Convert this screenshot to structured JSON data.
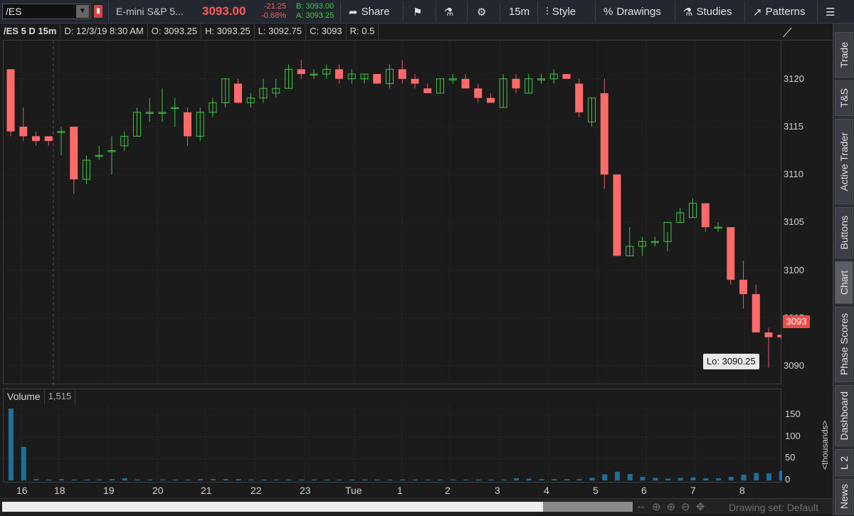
{
  "toolbar": {
    "symbol": "/ES",
    "description": "E-mini S&P 5...",
    "last": "3093.00",
    "net_change": "-21.25",
    "pct_change": "-0.68%",
    "bid": "B: 3093.00",
    "ask": "A: 3093.25",
    "share": "Share",
    "interval": "15m",
    "style": "Style",
    "drawings": "Drawings",
    "studies": "Studies",
    "patterns": "Patterns"
  },
  "chart_header": {
    "symbol": "/ES 5 D 15m",
    "date": "D: 12/3/19 8:30 AM",
    "open": "O: 3093.25",
    "high": "H: 3093.25",
    "low": "L: 3092.75",
    "close": "C: 3093",
    "range": "R: 0.5"
  },
  "price_axis": [
    "3120",
    "3115",
    "3110",
    "3105",
    "3100",
    "3095",
    "3090"
  ],
  "price_tag": "3093",
  "lo_tag": "Lo: 3090.25",
  "volume": {
    "title": "Volume",
    "value": "1,515",
    "axis": [
      "150",
      "100",
      "50",
      "0"
    ],
    "units": "<thousands>"
  },
  "date_axis": [
    "16",
    "18",
    "19",
    "20",
    "21",
    "22",
    "23",
    "Tue",
    "1",
    "2",
    "3",
    "4",
    "5",
    "6",
    "7",
    "8"
  ],
  "footer": {
    "drawing_set": "Drawing set: Default"
  },
  "right_tabs": [
    "Trade",
    "T&S",
    "Active Trader",
    "Buttons",
    "Chart",
    "Phase Scores",
    "Dashboard",
    "L 2",
    "News"
  ],
  "colors": {
    "up": "#3ec73e",
    "down": "#ff6b6b",
    "volume": "#1f6f9e"
  },
  "chart_data": {
    "type": "candlestick",
    "y_range": [
      3088,
      3124
    ],
    "candles": [
      {
        "o": 3121,
        "h": 3121,
        "l": 3114,
        "c": 3114.5
      },
      {
        "o": 3115,
        "h": 3117,
        "l": 3113.5,
        "c": 3114
      },
      {
        "o": 3114,
        "h": 3114.5,
        "l": 3113,
        "c": 3113.5
      },
      {
        "o": 3114,
        "h": 3114,
        "l": 3113,
        "c": 3113.5
      },
      {
        "o": 3114.5,
        "h": 3115,
        "l": 3112,
        "c": 3114.5
      },
      {
        "o": 3115,
        "h": 3115,
        "l": 3108,
        "c": 3109.5
      },
      {
        "o": 3109.5,
        "h": 3112,
        "l": 3109,
        "c": 3111.5
      },
      {
        "o": 3112,
        "h": 3113,
        "l": 3111.5,
        "c": 3112
      },
      {
        "o": 3112.5,
        "h": 3114,
        "l": 3110,
        "c": 3112.5
      },
      {
        "o": 3113,
        "h": 3114.5,
        "l": 3112.5,
        "c": 3114
      },
      {
        "o": 3114,
        "h": 3117,
        "l": 3114,
        "c": 3116.5
      },
      {
        "o": 3116.5,
        "h": 3118,
        "l": 3115.5,
        "c": 3116.5
      },
      {
        "o": 3116.5,
        "h": 3119,
        "l": 3115.5,
        "c": 3116.5
      },
      {
        "o": 3117,
        "h": 3118,
        "l": 3115,
        "c": 3117
      },
      {
        "o": 3116.5,
        "h": 3117,
        "l": 3113,
        "c": 3114
      },
      {
        "o": 3114,
        "h": 3117,
        "l": 3113.5,
        "c": 3116.5
      },
      {
        "o": 3116.5,
        "h": 3118,
        "l": 3116,
        "c": 3117.5
      },
      {
        "o": 3117.5,
        "h": 3120,
        "l": 3117,
        "c": 3120
      },
      {
        "o": 3119.5,
        "h": 3120,
        "l": 3117.5,
        "c": 3117.5
      },
      {
        "o": 3117.5,
        "h": 3118.5,
        "l": 3117,
        "c": 3118
      },
      {
        "o": 3118,
        "h": 3120,
        "l": 3117.5,
        "c": 3119
      },
      {
        "o": 3118.5,
        "h": 3120,
        "l": 3118,
        "c": 3119
      },
      {
        "o": 3119,
        "h": 3121.5,
        "l": 3119,
        "c": 3121
      },
      {
        "o": 3121,
        "h": 3122,
        "l": 3120,
        "c": 3120.5
      },
      {
        "o": 3120.5,
        "h": 3121,
        "l": 3120,
        "c": 3120.5
      },
      {
        "o": 3120.5,
        "h": 3121.5,
        "l": 3120,
        "c": 3121
      },
      {
        "o": 3121,
        "h": 3121.5,
        "l": 3119.5,
        "c": 3120
      },
      {
        "o": 3120,
        "h": 3121,
        "l": 3119.5,
        "c": 3120.5
      },
      {
        "o": 3120,
        "h": 3120.5,
        "l": 3119.5,
        "c": 3120.5
      },
      {
        "o": 3120.5,
        "h": 3120.5,
        "l": 3119.5,
        "c": 3119.5
      },
      {
        "o": 3119.5,
        "h": 3121.5,
        "l": 3119,
        "c": 3121
      },
      {
        "o": 3121,
        "h": 3122,
        "l": 3119.5,
        "c": 3120
      },
      {
        "o": 3120,
        "h": 3120.5,
        "l": 3119,
        "c": 3119.5
      },
      {
        "o": 3119,
        "h": 3119.5,
        "l": 3118.5,
        "c": 3118.5
      },
      {
        "o": 3118.5,
        "h": 3120,
        "l": 3118.5,
        "c": 3120
      },
      {
        "o": 3120,
        "h": 3120.5,
        "l": 3119.5,
        "c": 3120
      },
      {
        "o": 3120,
        "h": 3120.5,
        "l": 3119,
        "c": 3119
      },
      {
        "o": 3119,
        "h": 3119.5,
        "l": 3117.5,
        "c": 3118
      },
      {
        "o": 3118,
        "h": 3118.5,
        "l": 3117.5,
        "c": 3117.5
      },
      {
        "o": 3117,
        "h": 3120.5,
        "l": 3117,
        "c": 3120
      },
      {
        "o": 3120,
        "h": 3120.5,
        "l": 3118.5,
        "c": 3119
      },
      {
        "o": 3118.5,
        "h": 3120.5,
        "l": 3118.5,
        "c": 3120
      },
      {
        "o": 3120,
        "h": 3120.5,
        "l": 3119.5,
        "c": 3120
      },
      {
        "o": 3120,
        "h": 3121,
        "l": 3119.5,
        "c": 3120.5
      },
      {
        "o": 3120.5,
        "h": 3120.5,
        "l": 3120,
        "c": 3120
      },
      {
        "o": 3119.5,
        "h": 3120,
        "l": 3116,
        "c": 3116.5
      },
      {
        "o": 3115.5,
        "h": 3118,
        "l": 3115,
        "c": 3118
      },
      {
        "o": 3118.5,
        "h": 3120,
        "l": 3108.5,
        "c": 3110
      },
      {
        "o": 3110,
        "h": 3110,
        "l": 3101.5,
        "c": 3101.5
      },
      {
        "o": 3101.5,
        "h": 3104.5,
        "l": 3101.5,
        "c": 3102.5
      },
      {
        "o": 3102.5,
        "h": 3103.5,
        "l": 3101.5,
        "c": 3103
      },
      {
        "o": 3103,
        "h": 3103.5,
        "l": 3102.5,
        "c": 3103
      },
      {
        "o": 3103,
        "h": 3104,
        "l": 3102,
        "c": 3105
      },
      {
        "o": 3105,
        "h": 3106.5,
        "l": 3105,
        "c": 3106
      },
      {
        "o": 3105.5,
        "h": 3107.5,
        "l": 3105.5,
        "c": 3107
      },
      {
        "o": 3107,
        "h": 3107,
        "l": 3104,
        "c": 3104.5
      },
      {
        "o": 3104.5,
        "h": 3105,
        "l": 3104,
        "c": 3104.5
      },
      {
        "o": 3104.5,
        "h": 3104.5,
        "l": 3098.5,
        "c": 3099
      },
      {
        "o": 3099,
        "h": 3101,
        "l": 3096,
        "c": 3097.5
      },
      {
        "o": 3097.5,
        "h": 3098.5,
        "l": 3093.5,
        "c": 3093.5
      },
      {
        "o": 3093.5,
        "h": 3094,
        "l": 3090.25,
        "c": 3093
      },
      {
        "o": 3093.25,
        "h": 3093.25,
        "l": 3092.75,
        "c": 3093
      }
    ],
    "volume_k": [
      165,
      77,
      3,
      2,
      3,
      2,
      2,
      2,
      3,
      5,
      2,
      2,
      2,
      2,
      2,
      3,
      3,
      3,
      3,
      2,
      2,
      2,
      2,
      2,
      2,
      2,
      2,
      2,
      2,
      2,
      2,
      2,
      2,
      2,
      2,
      2,
      2,
      2,
      2,
      2,
      5,
      4,
      3,
      3,
      3,
      3,
      6,
      14,
      20,
      15,
      8,
      6,
      4,
      6,
      7,
      5,
      5,
      8,
      13,
      17,
      16,
      22
    ]
  }
}
